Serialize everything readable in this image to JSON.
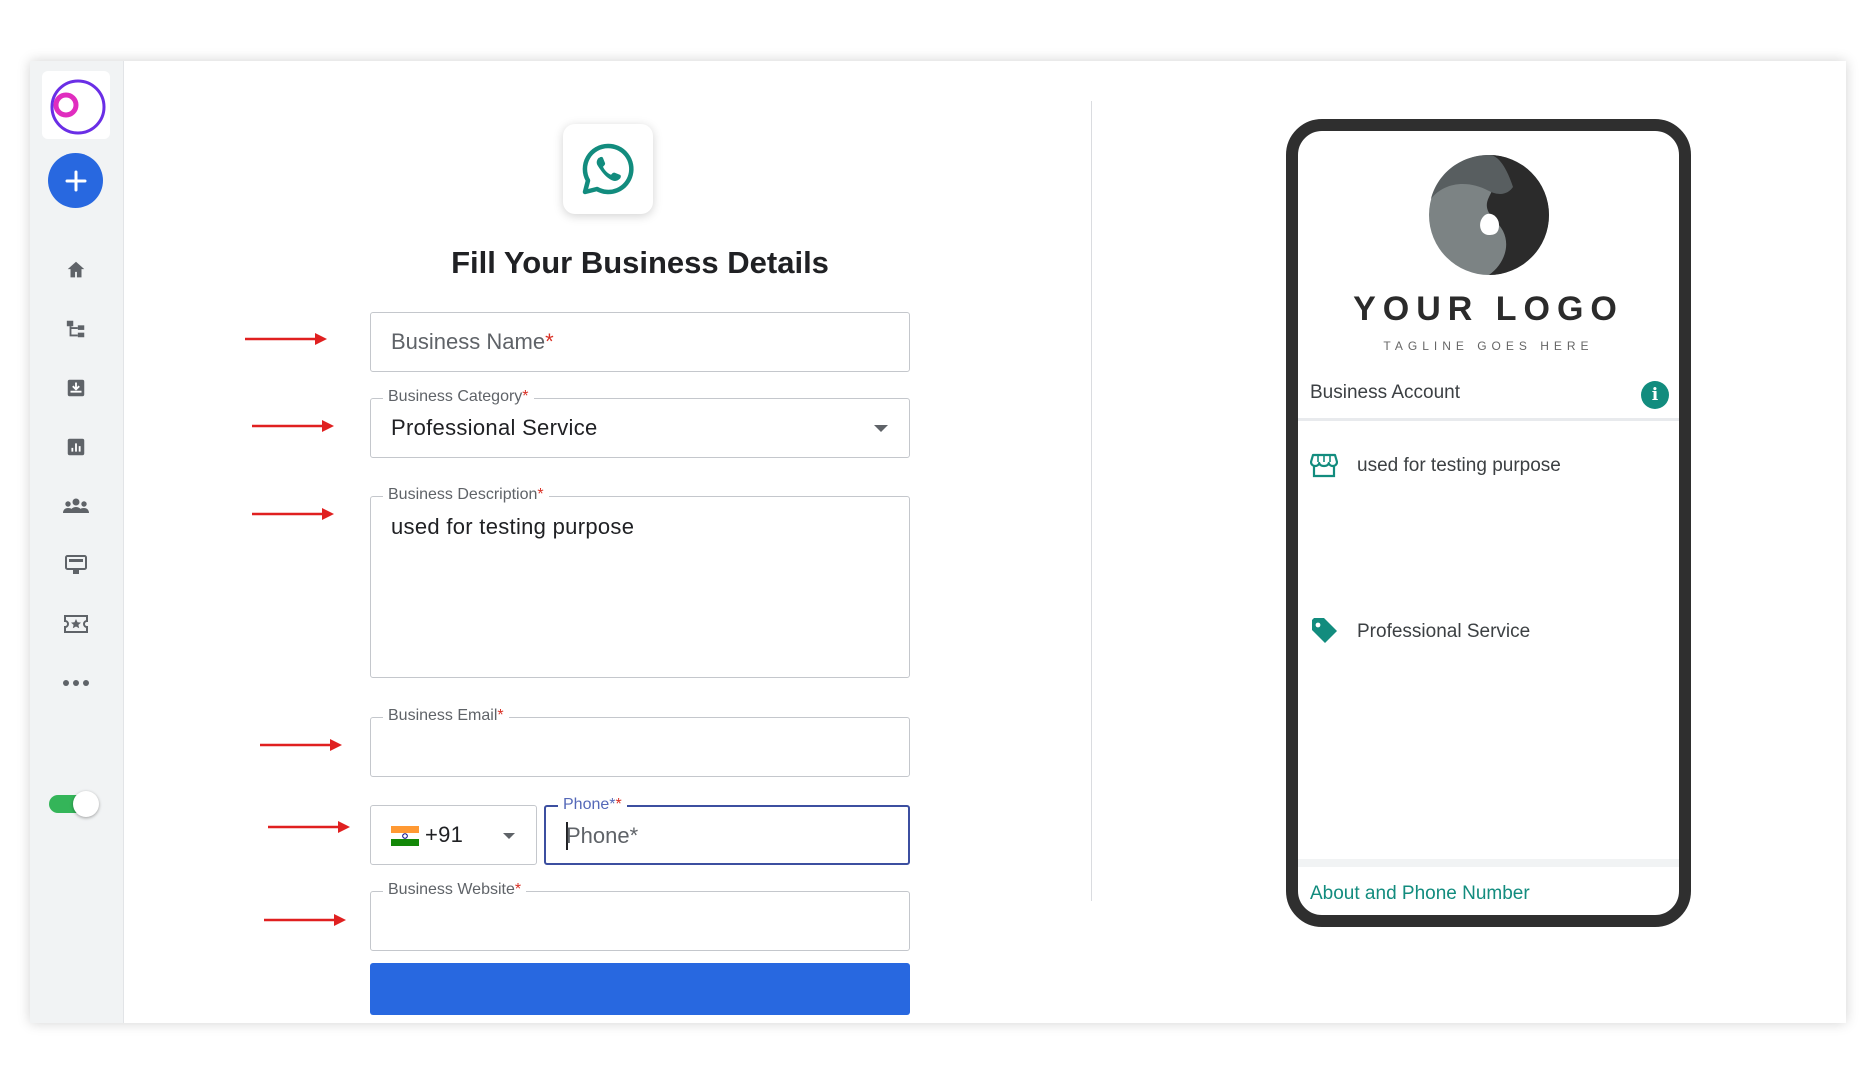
{
  "sidebar": {
    "add_icon": "plus-icon",
    "items": [
      {
        "icon": "home-icon"
      },
      {
        "icon": "flow-icon"
      },
      {
        "icon": "inbox-icon"
      },
      {
        "icon": "analytics-icon"
      },
      {
        "icon": "contacts-icon"
      },
      {
        "icon": "template-icon"
      },
      {
        "icon": "ticket-icon"
      },
      {
        "icon": "more-icon"
      }
    ],
    "toggle_on": true
  },
  "form": {
    "title": "Fill Your Business Details",
    "business_name": {
      "placeholder": "Business Name",
      "required_mark": "*",
      "value": ""
    },
    "business_category": {
      "label": "Business Category",
      "required_mark": "*",
      "value": "Professional Service"
    },
    "business_description": {
      "label": "Business Description",
      "required_mark": "*",
      "value": "used for testing purpose"
    },
    "business_email": {
      "label": "Business Email",
      "required_mark": "*",
      "value": ""
    },
    "country_code": {
      "value": "+91",
      "flag": "india-flag-icon"
    },
    "phone": {
      "label": "Phone*",
      "required_mark": "*",
      "placeholder": "Phone*",
      "value": ""
    },
    "business_website": {
      "label": "Business Website",
      "required_mark": "*",
      "value": ""
    },
    "submit_label": ""
  },
  "preview": {
    "logo_text": "YOUR LOGO",
    "tagline": "TAGLINE GOES HERE",
    "account_type": "Business Account",
    "description": "used for testing purpose",
    "category": "Professional Service",
    "footer_link": "About and Phone Number"
  },
  "colors": {
    "accent": "#2868e0",
    "whatsapp": "#128c7e",
    "annotation_arrow": "#e02020",
    "toggle": "#34b559"
  }
}
